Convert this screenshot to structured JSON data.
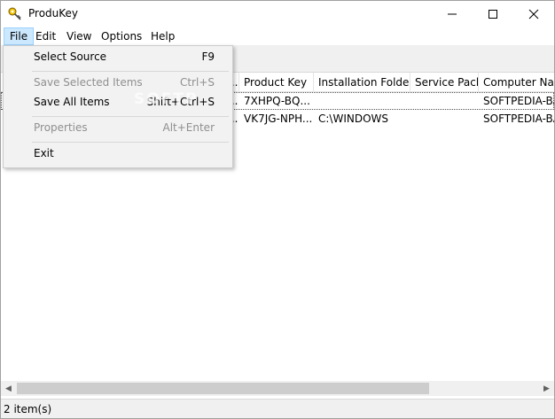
{
  "window": {
    "title": "ProduKey"
  },
  "menubar": {
    "items": [
      "File",
      "Edit",
      "View",
      "Options",
      "Help"
    ]
  },
  "file_menu": {
    "items": [
      {
        "label": "Select Source",
        "shortcut": "F9",
        "enabled": true
      },
      {
        "label": "Save Selected Items",
        "shortcut": "Ctrl+S",
        "enabled": false
      },
      {
        "label": "Save All Items",
        "shortcut": "Shift+Ctrl+S",
        "enabled": true
      },
      {
        "label": "Properties",
        "shortcut": "Alt+Enter",
        "enabled": false
      },
      {
        "label": "Exit",
        "shortcut": "",
        "enabled": true
      }
    ]
  },
  "list": {
    "columns": [
      "...",
      "Product Key",
      "Installation Folder",
      "Service Pack",
      "Computer Name"
    ],
    "rows": [
      {
        "col0": "...",
        "product_key": "7XHPQ-BQ...",
        "installation_folder": "",
        "service_pack": "",
        "computer_name": "SOFTPEDIA-BA"
      },
      {
        "col0": "...",
        "product_key": "VK7JG-NPH...",
        "installation_folder": "C:\\WINDOWS",
        "service_pack": "",
        "computer_name": "SOFTPEDIA-BA"
      }
    ]
  },
  "statusbar": {
    "text": "2 item(s)"
  },
  "watermark": "SOFTP",
  "colors": {
    "menu_highlight": "#cce8ff",
    "menu_highlight_border": "#99d1ff",
    "disabled_text": "#8f8f8f"
  }
}
